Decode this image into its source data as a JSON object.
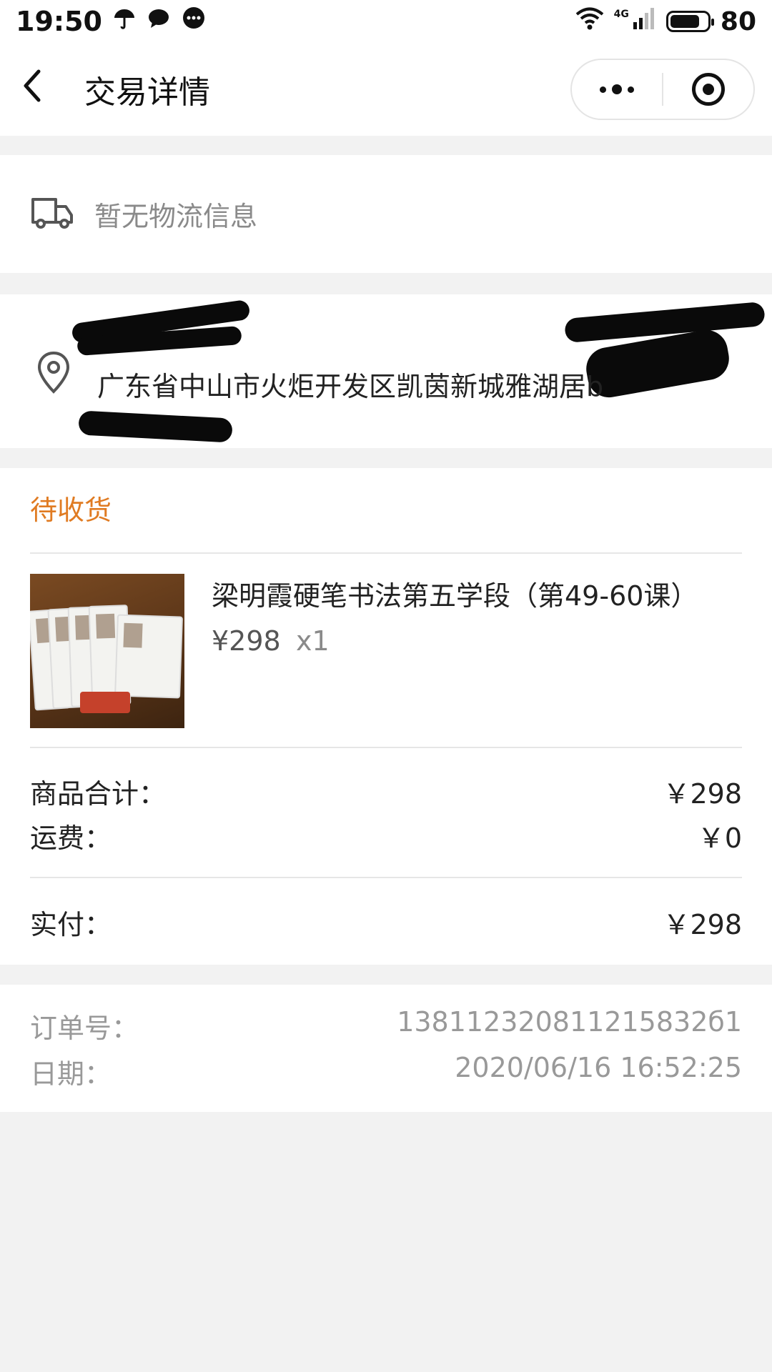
{
  "status_bar": {
    "time": "19:50",
    "network": "4G",
    "battery": "80",
    "battery_level_percent": 80,
    "icons": [
      "umbrella-icon",
      "message-icon",
      "chat-bubble-icon",
      "wifi-icon",
      "signal-icon",
      "battery-icon"
    ]
  },
  "nav": {
    "back_icon": "chevron-left-icon",
    "title": "交易详情",
    "capsule_icons": [
      "more-dots-icon",
      "close-target-icon"
    ]
  },
  "logistics": {
    "icon": "truck-icon",
    "text": "暂无物流信息"
  },
  "address": {
    "icon": "location-pin-icon",
    "line": "广东省中山市火炬开发区凯茵新城雅湖居b",
    "redacted": true
  },
  "order": {
    "status": "待收货",
    "product": {
      "title": "梁明霞硬笔书法第五学段（第49-60课）",
      "price": "¥298",
      "qty": "x1"
    },
    "subtotal_label": "商品合计：",
    "subtotal_value": "￥298",
    "shipping_label": "运费：",
    "shipping_value": "￥0",
    "paid_label": "实付：",
    "paid_value": "￥298"
  },
  "meta": {
    "order_no_label": "订单号：",
    "order_no_value": "138112320811215832б1",
    "date_label": "日期：",
    "date_value": "2020/06/16 16:52:25"
  },
  "colors": {
    "status_orange": "#e07b22",
    "page_bg": "#f2f2f2",
    "card_bg": "#ffffff"
  }
}
